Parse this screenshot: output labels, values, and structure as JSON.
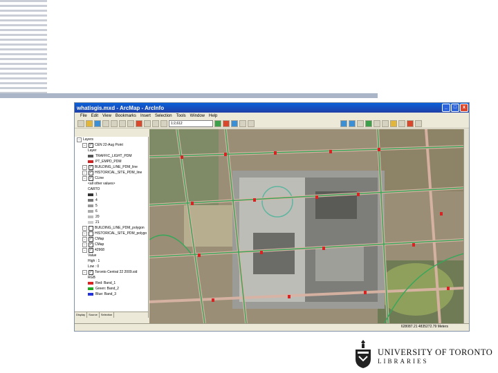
{
  "window": {
    "title": "whatisgis.mxd - ArcMap - ArcInfo",
    "min_label": "_",
    "max_label": "□",
    "close_label": "x"
  },
  "menu": [
    "File",
    "Edit",
    "View",
    "Bookmarks",
    "Insert",
    "Selection",
    "Tools",
    "Window",
    "Help"
  ],
  "toolbar": {
    "scale": "1:2,612"
  },
  "toc": {
    "items": [
      {
        "label": "Layers",
        "indent": 0,
        "type": "group"
      },
      {
        "label": "CEN 22-Aug Point",
        "indent": 1,
        "type": "layer",
        "checked": true
      },
      {
        "label": "Layer",
        "indent": 2,
        "type": "text"
      },
      {
        "label": "TRAFFIC_LIGHT_PDM",
        "indent": 2,
        "type": "symbol",
        "color": "#555555"
      },
      {
        "label": "PT_EMPD_PDM",
        "indent": 2,
        "type": "symbol",
        "color": "#cc2222"
      },
      {
        "label": "BUILDING_LINE_PDM_line",
        "indent": 1,
        "type": "layer",
        "checked": true
      },
      {
        "label": "HISTORICAL_SITE_PDM_line",
        "indent": 1,
        "type": "layer",
        "checked": true
      },
      {
        "label": "CLine",
        "indent": 1,
        "type": "layer",
        "checked": true
      },
      {
        "label": "<all other values>",
        "indent": 2,
        "type": "text"
      },
      {
        "label": "CARTO",
        "indent": 2,
        "type": "text"
      },
      {
        "label": "1",
        "indent": 2,
        "type": "symbol",
        "color": "#333333"
      },
      {
        "label": "4",
        "indent": 2,
        "type": "symbol",
        "color": "#777777"
      },
      {
        "label": "5",
        "indent": 2,
        "type": "symbol",
        "color": "#999999"
      },
      {
        "label": "6",
        "indent": 2,
        "type": "symbol",
        "color": "#aaaaaa"
      },
      {
        "label": "20",
        "indent": 2,
        "type": "symbol",
        "color": "#bbbbbb"
      },
      {
        "label": "21",
        "indent": 2,
        "type": "symbol",
        "color": "#cccccc"
      },
      {
        "label": "BUILDING_LINE_PDM_polygon",
        "indent": 1,
        "type": "layer",
        "checked": false
      },
      {
        "label": "HISTORICAL_SITE_PDM_polygo",
        "indent": 1,
        "type": "layer",
        "checked": false
      },
      {
        "label": "CMap",
        "indent": 1,
        "type": "layer",
        "checked": true
      },
      {
        "label": "CMap",
        "indent": 1,
        "type": "layer",
        "checked": true
      },
      {
        "label": "42968",
        "indent": 1,
        "type": "layer",
        "checked": true
      },
      {
        "label": "Value",
        "indent": 2,
        "type": "text"
      },
      {
        "label": "High : 1",
        "indent": 2,
        "type": "text"
      },
      {
        "label": "Low : 0",
        "indent": 2,
        "type": "text"
      },
      {
        "label": "Toronto Central 22 2009.sid",
        "indent": 1,
        "type": "layer",
        "checked": true
      },
      {
        "label": "RGB",
        "indent": 2,
        "type": "text"
      },
      {
        "label": "Red: Band_1",
        "indent": 2,
        "type": "symbol",
        "color": "#dd2222"
      },
      {
        "label": "Green: Band_2",
        "indent": 2,
        "type": "symbol",
        "color": "#22aa22"
      },
      {
        "label": "Blue: Band_3",
        "indent": 2,
        "type": "symbol",
        "color": "#2233dd"
      }
    ],
    "tabs": [
      "Display",
      "Source",
      "Selection"
    ]
  },
  "status": {
    "coordinates": "628087.21  4835272.79 Meters"
  },
  "branding": {
    "university": "UNIVERSITY OF TORONTO",
    "libraries": "LIBRARIES"
  }
}
